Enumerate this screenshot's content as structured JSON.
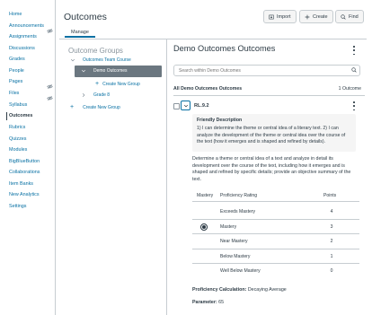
{
  "sidebar": {
    "items": [
      {
        "label": "Home"
      },
      {
        "label": "Announcements",
        "hidden_icon": true
      },
      {
        "label": "Assignments"
      },
      {
        "label": "Discussions"
      },
      {
        "label": "Grades"
      },
      {
        "label": "People"
      },
      {
        "label": "Pages",
        "hidden_icon": true
      },
      {
        "label": "Files",
        "hidden_icon": true
      },
      {
        "label": "Syllabus"
      },
      {
        "label": "Outcomes",
        "active": true
      },
      {
        "label": "Rubrics"
      },
      {
        "label": "Quizzes"
      },
      {
        "label": "Modules"
      },
      {
        "label": "BigBlueButton"
      },
      {
        "label": "Collaborations"
      },
      {
        "label": "Item Banks"
      },
      {
        "label": "New Analytics"
      },
      {
        "label": "Settings"
      }
    ]
  },
  "header": {
    "title": "Outcomes",
    "import_label": "Import",
    "create_label": "Create",
    "find_label": "Find"
  },
  "tabs": {
    "manage": "Manage"
  },
  "groups": {
    "title": "Outcome Groups",
    "tree": {
      "root": "Outcomes Team Course",
      "selected": "Demo Outcomes",
      "create_new_group": "Create New Group",
      "grade": "Grade 8",
      "create_new_group_root": "Create New Group"
    }
  },
  "main": {
    "title": "Demo Outcomes Outcomes",
    "search_placeholder": "Search within Demo Outcomes",
    "all_label": "All Demo Outcomes Outcomes",
    "count_label": "1 Outcome",
    "outcome": {
      "code": "RL.9.2",
      "friendly_title": "Friendly Description",
      "friendly_text": "1) I can determine the theme or central idea of a literary text. 2) I can analyze the development of the theme or central idea over the course of the text (how it emerges and is shaped and refined by details).",
      "description": "Determine a theme or central idea of a text and analyze in detail its development over the course of the text, including how it emerges and is shaped and refined by specific details; provide an objective summary of the text.",
      "ratings_header": {
        "mastery": "Mastery",
        "proficiency": "Proficiency Rating",
        "points": "Points"
      },
      "ratings": [
        {
          "label": "Exceeds Mastery",
          "points": "4",
          "mastery": false
        },
        {
          "label": "Mastery",
          "points": "3",
          "mastery": true
        },
        {
          "label": "Near Mastery",
          "points": "2",
          "mastery": false
        },
        {
          "label": "Below Mastery",
          "points": "1",
          "mastery": false
        },
        {
          "label": "Well Below Mastery",
          "points": "0",
          "mastery": false
        }
      ],
      "calc_label": "Proficiency Calculation:",
      "calc_value": "Decaying Average",
      "param_label": "Parameter:",
      "param_value": "65"
    }
  },
  "colors": {
    "link": "#0770a3",
    "text": "#2d3b45",
    "selected_bg": "#6b7780",
    "border": "#c7cdd1"
  }
}
